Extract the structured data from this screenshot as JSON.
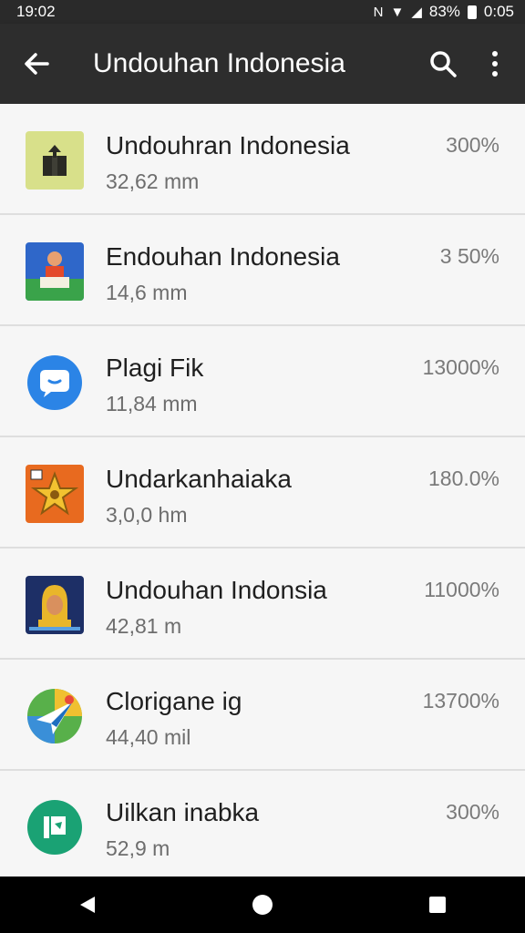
{
  "status": {
    "time": "19:02",
    "signal": "N",
    "battery": "83%",
    "clock": "0:05"
  },
  "toolbar": {
    "title": "Undouhan Indonesia"
  },
  "items": [
    {
      "name": "Undouhran Indonesia",
      "size": "32,62 mm",
      "percent": "300%",
      "icon": "package-box-icon",
      "color": "#d8e08a"
    },
    {
      "name": "Endouhan Indonesia",
      "size": "14,6 mm",
      "percent": "3 50%",
      "icon": "reading-person-icon",
      "color": "#2f67c9"
    },
    {
      "name": "Plagi Fik",
      "size": "11,84 mm",
      "percent": "13000%",
      "icon": "chat-bubble-icon",
      "color": "#2b84e6"
    },
    {
      "name": "Undarkanhaiaka",
      "size": "3,0,0 hm",
      "percent": "180.0%",
      "icon": "star-badge-icon",
      "color": "#e86a1f"
    },
    {
      "name": "Undouhan Indonsia",
      "size": "42,81 m",
      "percent": "11000%",
      "icon": "person-portrait-icon",
      "color": "#1d2f66"
    },
    {
      "name": "Clorigane ig",
      "size": "44,40 mil",
      "percent": "13700%",
      "icon": "paper-plane-icon",
      "color": "#58b04a"
    },
    {
      "name": "Uilkan inabka",
      "size": "52,9 m",
      "percent": "300%",
      "icon": "flag-icon",
      "color": "#1aa274"
    }
  ]
}
